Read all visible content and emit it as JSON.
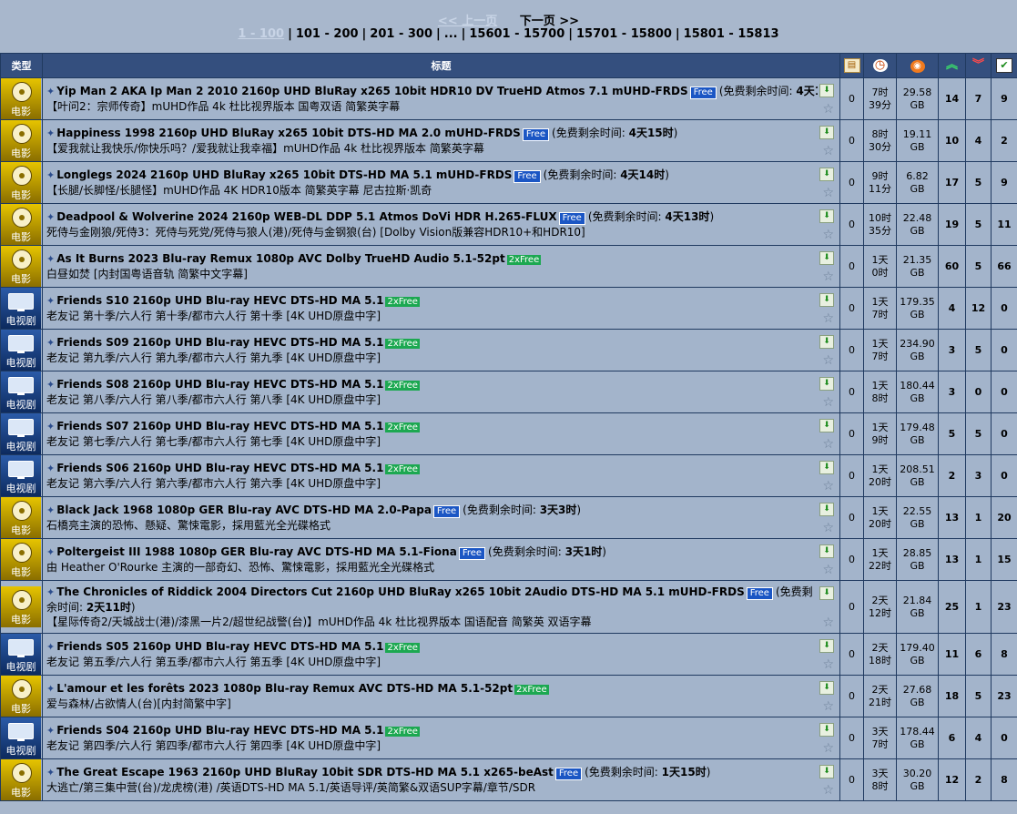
{
  "pager": {
    "prev": "<< 上一页",
    "next": "下一页 >>",
    "current": "1 - 100",
    "pages": [
      "101 - 200",
      "201 - 300",
      "...",
      "15601 - 15700",
      "15701 - 15800",
      "15801 - 15813"
    ]
  },
  "header": {
    "type": "类型",
    "title": "标题",
    "icons": [
      "comments-icon",
      "clock-icon",
      "size-icon",
      "seeders-icon",
      "leechers-icon",
      "completed-icon"
    ]
  },
  "rows": [
    {
      "cat": "movie",
      "cat_label": "电影",
      "title": "Yip Man 2 AKA Ip Man 2 2010 2160p UHD BluRay x265 10bit HDR10 DV TrueHD Atmos 7.1 mUHD-FRDS",
      "badge": "Free",
      "free_label": "免费剩余时间: ",
      "free_time": "4天16时",
      "sub": "【叶问2：宗师传奇】mUHD作品 4k 杜比视界版本 国粤双语 简繁英字幕",
      "comments": "0",
      "time1": "7时",
      "time2": "39分",
      "size1": "29.58",
      "size2": "GB",
      "seeders": "14",
      "leechers": "7",
      "done": "9"
    },
    {
      "cat": "movie",
      "cat_label": "电影",
      "title": "Happiness 1998 2160p UHD BluRay x265 10bit DTS-HD MA 2.0 mUHD-FRDS",
      "badge": "Free",
      "free_label": "免费剩余时间: ",
      "free_time": "4天15时",
      "sub": "【爱我就让我快乐/你快乐吗？/爱我就让我幸福】mUHD作品 4k 杜比视界版本 简繁英字幕",
      "comments": "0",
      "time1": "8时",
      "time2": "30分",
      "size1": "19.11",
      "size2": "GB",
      "seeders": "10",
      "leechers": "4",
      "done": "2"
    },
    {
      "cat": "movie",
      "cat_label": "电影",
      "title": "Longlegs 2024 2160p UHD BluRay x265 10bit DTS-HD MA 5.1 mUHD-FRDS",
      "badge": "Free",
      "free_label": "免费剩余时间: ",
      "free_time": "4天14时",
      "sub": "【长腿/长脚怪/长腿怪】mUHD作品 4K HDR10版本 简繁英字幕 尼古拉斯·凯奇",
      "comments": "0",
      "time1": "9时",
      "time2": "11分",
      "size1": "6.82",
      "size2": "GB",
      "seeders": "17",
      "leechers": "5",
      "done": "9"
    },
    {
      "cat": "movie",
      "cat_label": "电影",
      "title": "Deadpool & Wolverine 2024 2160p WEB-DL DDP 5.1 Atmos DoVi HDR H.265-FLUX",
      "badge": "Free",
      "free_label": "免费剩余时间: ",
      "free_time": "4天13时",
      "sub": "死侍与金刚狼/死侍3：死侍与死党/死侍与狼人(港)/死侍与金钢狼(台) [Dolby Vision版兼容HDR10+和HDR10]",
      "comments": "0",
      "time1": "10时",
      "time2": "35分",
      "size1": "22.48",
      "size2": "GB",
      "seeders": "19",
      "leechers": "5",
      "done": "11"
    },
    {
      "cat": "movie",
      "cat_label": "电影",
      "title": "As It Burns 2023 Blu-ray Remux 1080p AVC Dolby TrueHD Audio 5.1-52pt",
      "badge": "2xFree",
      "free_label": "",
      "free_time": "",
      "sub": "白昼如焚 [内封国粤语音轨 简繁中文字幕]",
      "comments": "0",
      "time1": "1天",
      "time2": "0时",
      "size1": "21.35",
      "size2": "GB",
      "seeders": "60",
      "leechers": "5",
      "done": "66"
    },
    {
      "cat": "tv",
      "cat_label": "电视剧",
      "title": "Friends S10 2160p UHD Blu-ray HEVC DTS-HD MA 5.1",
      "badge": "2xFree",
      "free_label": "",
      "free_time": "",
      "sub": "老友记 第十季/六人行 第十季/都市六人行 第十季 [4K UHD原盘中字]",
      "comments": "0",
      "time1": "1天",
      "time2": "7时",
      "size1": "179.35",
      "size2": "GB",
      "seeders": "4",
      "leechers": "12",
      "done": "0"
    },
    {
      "cat": "tv",
      "cat_label": "电视剧",
      "title": "Friends S09 2160p UHD Blu-ray HEVC DTS-HD MA 5.1",
      "badge": "2xFree",
      "free_label": "",
      "free_time": "",
      "sub": "老友记 第九季/六人行 第九季/都市六人行 第九季 [4K UHD原盘中字]",
      "comments": "0",
      "time1": "1天",
      "time2": "7时",
      "size1": "234.90",
      "size2": "GB",
      "seeders": "3",
      "leechers": "5",
      "done": "0"
    },
    {
      "cat": "tv",
      "cat_label": "电视剧",
      "title": "Friends S08 2160p UHD Blu-ray HEVC DTS-HD MA 5.1",
      "badge": "2xFree",
      "free_label": "",
      "free_time": "",
      "sub": "老友记 第八季/六人行 第八季/都市六人行 第八季 [4K UHD原盘中字]",
      "comments": "0",
      "time1": "1天",
      "time2": "8时",
      "size1": "180.44",
      "size2": "GB",
      "seeders": "3",
      "leechers": "0",
      "done": "0"
    },
    {
      "cat": "tv",
      "cat_label": "电视剧",
      "title": "Friends S07 2160p UHD Blu-ray HEVC DTS-HD MA 5.1",
      "badge": "2xFree",
      "free_label": "",
      "free_time": "",
      "sub": "老友记 第七季/六人行 第七季/都市六人行 第七季 [4K UHD原盘中字]",
      "comments": "0",
      "time1": "1天",
      "time2": "9时",
      "size1": "179.48",
      "size2": "GB",
      "seeders": "5",
      "leechers": "5",
      "done": "0"
    },
    {
      "cat": "tv",
      "cat_label": "电视剧",
      "title": "Friends S06 2160p UHD Blu-ray HEVC DTS-HD MA 5.1",
      "badge": "2xFree",
      "free_label": "",
      "free_time": "",
      "sub": "老友记 第六季/六人行 第六季/都市六人行 第六季 [4K UHD原盘中字]",
      "comments": "0",
      "time1": "1天",
      "time2": "20时",
      "size1": "208.51",
      "size2": "GB",
      "seeders": "2",
      "leechers": "3",
      "done": "0"
    },
    {
      "cat": "movie",
      "cat_label": "电影",
      "title": "Black Jack 1968 1080p GER Blu-ray AVC DTS-HD MA 2.0-Papa",
      "badge": "Free",
      "free_label": "免费剩余时间: ",
      "free_time": "3天3时",
      "sub": "石橋亮主演的恐怖、懸疑、驚悚電影，採用藍光全光碟格式",
      "comments": "0",
      "time1": "1天",
      "time2": "20时",
      "size1": "22.55",
      "size2": "GB",
      "seeders": "13",
      "leechers": "1",
      "done": "20"
    },
    {
      "cat": "movie",
      "cat_label": "电影",
      "title": "Poltergeist III 1988 1080p GER Blu-ray AVC DTS-HD MA 5.1-Fiona",
      "badge": "Free",
      "free_label": "免费剩余时间: ",
      "free_time": "3天1时",
      "sub": "由 Heather O'Rourke 主演的一部奇幻、恐怖、驚悚電影，採用藍光全光碟格式",
      "comments": "0",
      "time1": "1天",
      "time2": "22时",
      "size1": "28.85",
      "size2": "GB",
      "seeders": "13",
      "leechers": "1",
      "done": "15"
    },
    {
      "cat": "movie",
      "cat_label": "电影",
      "title": "The Chronicles of Riddick 2004 Directors Cut 2160p UHD BluRay x265 10bit 2Audio DTS-HD MA 5.1 mUHD-FRDS",
      "badge": "Free",
      "free_label": "免费剩余时间: ",
      "free_time": "2天11时",
      "sub": "【星际传奇2/天城战士(港)/漆黑一片2/超世纪战警(台)】mUHD作品 4k 杜比视界版本 国语配音 简繁英 双语字幕",
      "comments": "0",
      "time1": "2天",
      "time2": "12时",
      "size1": "21.84",
      "size2": "GB",
      "seeders": "25",
      "leechers": "1",
      "done": "23",
      "tall": true
    },
    {
      "cat": "tv",
      "cat_label": "电视剧",
      "title": "Friends S05 2160p UHD Blu-ray HEVC DTS-HD MA 5.1",
      "badge": "2xFree",
      "free_label": "",
      "free_time": "",
      "sub": "老友记 第五季/六人行 第五季/都市六人行 第五季 [4K UHD原盘中字]",
      "comments": "0",
      "time1": "2天",
      "time2": "18时",
      "size1": "179.40",
      "size2": "GB",
      "seeders": "11",
      "leechers": "6",
      "done": "8"
    },
    {
      "cat": "movie",
      "cat_label": "电影",
      "title": "L'amour et les forêts 2023 1080p Blu-ray Remux AVC DTS-HD MA 5.1-52pt",
      "badge": "2xFree",
      "free_label": "",
      "free_time": "",
      "sub": "爱与森林/占欲情人(台)[内封简繁中字]",
      "comments": "0",
      "time1": "2天",
      "time2": "21时",
      "size1": "27.68",
      "size2": "GB",
      "seeders": "18",
      "leechers": "5",
      "done": "23"
    },
    {
      "cat": "tv",
      "cat_label": "电视剧",
      "title": "Friends S04 2160p UHD Blu-ray HEVC DTS-HD MA 5.1",
      "badge": "2xFree",
      "free_label": "",
      "free_time": "",
      "sub": "老友记 第四季/六人行 第四季/都市六人行 第四季 [4K UHD原盘中字]",
      "comments": "0",
      "time1": "3天",
      "time2": "7时",
      "size1": "178.44",
      "size2": "GB",
      "seeders": "6",
      "leechers": "4",
      "done": "0"
    },
    {
      "cat": "movie",
      "cat_label": "电影",
      "title": "The Great Escape 1963 2160p UHD BluRay 10bit SDR DTS-HD MA 5.1 x265-beAst",
      "badge": "Free",
      "free_label": "免费剩余时间: ",
      "free_time": "1天15时",
      "sub": "大逃亡/第三集中营(台)/龙虎榜(港) /英语DTS-HD MA 5.1/英语导评/英简繁&双语SUP字幕/章节/SDR",
      "comments": "0",
      "time1": "3天",
      "time2": "8时",
      "size1": "30.20",
      "size2": "GB",
      "seeders": "12",
      "leechers": "2",
      "done": "8"
    }
  ]
}
